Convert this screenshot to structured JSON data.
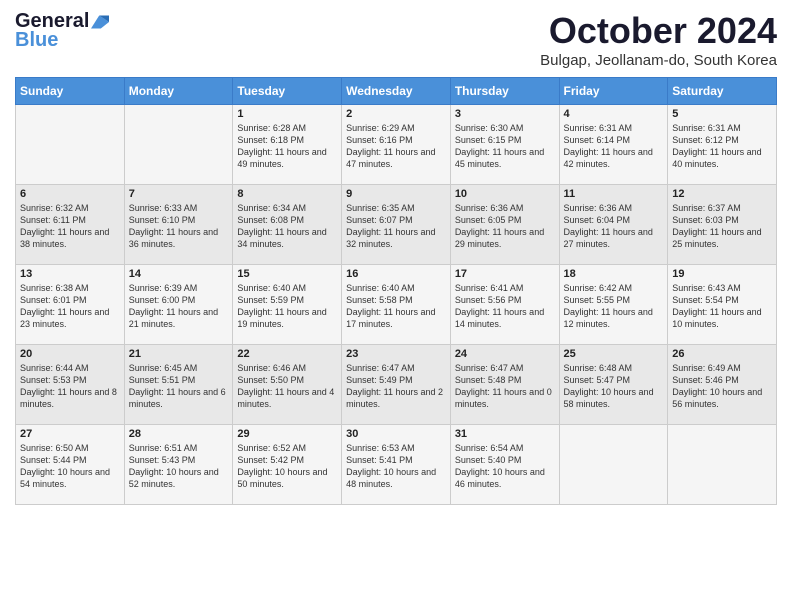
{
  "header": {
    "logo_general": "General",
    "logo_blue": "Blue",
    "month_title": "October 2024",
    "location": "Bulgap, Jeollanam-do, South Korea"
  },
  "weekdays": [
    "Sunday",
    "Monday",
    "Tuesday",
    "Wednesday",
    "Thursday",
    "Friday",
    "Saturday"
  ],
  "weeks": [
    [
      {
        "day": "",
        "sunrise": "",
        "sunset": "",
        "daylight": ""
      },
      {
        "day": "",
        "sunrise": "",
        "sunset": "",
        "daylight": ""
      },
      {
        "day": "1",
        "sunrise": "Sunrise: 6:28 AM",
        "sunset": "Sunset: 6:18 PM",
        "daylight": "Daylight: 11 hours and 49 minutes."
      },
      {
        "day": "2",
        "sunrise": "Sunrise: 6:29 AM",
        "sunset": "Sunset: 6:16 PM",
        "daylight": "Daylight: 11 hours and 47 minutes."
      },
      {
        "day": "3",
        "sunrise": "Sunrise: 6:30 AM",
        "sunset": "Sunset: 6:15 PM",
        "daylight": "Daylight: 11 hours and 45 minutes."
      },
      {
        "day": "4",
        "sunrise": "Sunrise: 6:31 AM",
        "sunset": "Sunset: 6:14 PM",
        "daylight": "Daylight: 11 hours and 42 minutes."
      },
      {
        "day": "5",
        "sunrise": "Sunrise: 6:31 AM",
        "sunset": "Sunset: 6:12 PM",
        "daylight": "Daylight: 11 hours and 40 minutes."
      }
    ],
    [
      {
        "day": "6",
        "sunrise": "Sunrise: 6:32 AM",
        "sunset": "Sunset: 6:11 PM",
        "daylight": "Daylight: 11 hours and 38 minutes."
      },
      {
        "day": "7",
        "sunrise": "Sunrise: 6:33 AM",
        "sunset": "Sunset: 6:10 PM",
        "daylight": "Daylight: 11 hours and 36 minutes."
      },
      {
        "day": "8",
        "sunrise": "Sunrise: 6:34 AM",
        "sunset": "Sunset: 6:08 PM",
        "daylight": "Daylight: 11 hours and 34 minutes."
      },
      {
        "day": "9",
        "sunrise": "Sunrise: 6:35 AM",
        "sunset": "Sunset: 6:07 PM",
        "daylight": "Daylight: 11 hours and 32 minutes."
      },
      {
        "day": "10",
        "sunrise": "Sunrise: 6:36 AM",
        "sunset": "Sunset: 6:05 PM",
        "daylight": "Daylight: 11 hours and 29 minutes."
      },
      {
        "day": "11",
        "sunrise": "Sunrise: 6:36 AM",
        "sunset": "Sunset: 6:04 PM",
        "daylight": "Daylight: 11 hours and 27 minutes."
      },
      {
        "day": "12",
        "sunrise": "Sunrise: 6:37 AM",
        "sunset": "Sunset: 6:03 PM",
        "daylight": "Daylight: 11 hours and 25 minutes."
      }
    ],
    [
      {
        "day": "13",
        "sunrise": "Sunrise: 6:38 AM",
        "sunset": "Sunset: 6:01 PM",
        "daylight": "Daylight: 11 hours and 23 minutes."
      },
      {
        "day": "14",
        "sunrise": "Sunrise: 6:39 AM",
        "sunset": "Sunset: 6:00 PM",
        "daylight": "Daylight: 11 hours and 21 minutes."
      },
      {
        "day": "15",
        "sunrise": "Sunrise: 6:40 AM",
        "sunset": "Sunset: 5:59 PM",
        "daylight": "Daylight: 11 hours and 19 minutes."
      },
      {
        "day": "16",
        "sunrise": "Sunrise: 6:40 AM",
        "sunset": "Sunset: 5:58 PM",
        "daylight": "Daylight: 11 hours and 17 minutes."
      },
      {
        "day": "17",
        "sunrise": "Sunrise: 6:41 AM",
        "sunset": "Sunset: 5:56 PM",
        "daylight": "Daylight: 11 hours and 14 minutes."
      },
      {
        "day": "18",
        "sunrise": "Sunrise: 6:42 AM",
        "sunset": "Sunset: 5:55 PM",
        "daylight": "Daylight: 11 hours and 12 minutes."
      },
      {
        "day": "19",
        "sunrise": "Sunrise: 6:43 AM",
        "sunset": "Sunset: 5:54 PM",
        "daylight": "Daylight: 11 hours and 10 minutes."
      }
    ],
    [
      {
        "day": "20",
        "sunrise": "Sunrise: 6:44 AM",
        "sunset": "Sunset: 5:53 PM",
        "daylight": "Daylight: 11 hours and 8 minutes."
      },
      {
        "day": "21",
        "sunrise": "Sunrise: 6:45 AM",
        "sunset": "Sunset: 5:51 PM",
        "daylight": "Daylight: 11 hours and 6 minutes."
      },
      {
        "day": "22",
        "sunrise": "Sunrise: 6:46 AM",
        "sunset": "Sunset: 5:50 PM",
        "daylight": "Daylight: 11 hours and 4 minutes."
      },
      {
        "day": "23",
        "sunrise": "Sunrise: 6:47 AM",
        "sunset": "Sunset: 5:49 PM",
        "daylight": "Daylight: 11 hours and 2 minutes."
      },
      {
        "day": "24",
        "sunrise": "Sunrise: 6:47 AM",
        "sunset": "Sunset: 5:48 PM",
        "daylight": "Daylight: 11 hours and 0 minutes."
      },
      {
        "day": "25",
        "sunrise": "Sunrise: 6:48 AM",
        "sunset": "Sunset: 5:47 PM",
        "daylight": "Daylight: 10 hours and 58 minutes."
      },
      {
        "day": "26",
        "sunrise": "Sunrise: 6:49 AM",
        "sunset": "Sunset: 5:46 PM",
        "daylight": "Daylight: 10 hours and 56 minutes."
      }
    ],
    [
      {
        "day": "27",
        "sunrise": "Sunrise: 6:50 AM",
        "sunset": "Sunset: 5:44 PM",
        "daylight": "Daylight: 10 hours and 54 minutes."
      },
      {
        "day": "28",
        "sunrise": "Sunrise: 6:51 AM",
        "sunset": "Sunset: 5:43 PM",
        "daylight": "Daylight: 10 hours and 52 minutes."
      },
      {
        "day": "29",
        "sunrise": "Sunrise: 6:52 AM",
        "sunset": "Sunset: 5:42 PM",
        "daylight": "Daylight: 10 hours and 50 minutes."
      },
      {
        "day": "30",
        "sunrise": "Sunrise: 6:53 AM",
        "sunset": "Sunset: 5:41 PM",
        "daylight": "Daylight: 10 hours and 48 minutes."
      },
      {
        "day": "31",
        "sunrise": "Sunrise: 6:54 AM",
        "sunset": "Sunset: 5:40 PM",
        "daylight": "Daylight: 10 hours and 46 minutes."
      },
      {
        "day": "",
        "sunrise": "",
        "sunset": "",
        "daylight": ""
      },
      {
        "day": "",
        "sunrise": "",
        "sunset": "",
        "daylight": ""
      }
    ]
  ]
}
